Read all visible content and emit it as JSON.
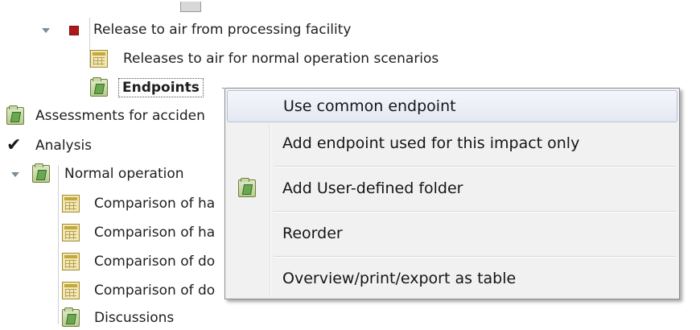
{
  "tree": {
    "items": [
      {
        "label": "Release to air from processing facility"
      },
      {
        "label": "Releases to air for normal operation scenarios"
      },
      {
        "label": "Endpoints"
      },
      {
        "label": "Assessments for acciden"
      },
      {
        "label": "Analysis"
      },
      {
        "label": "Normal operation"
      },
      {
        "label": "Comparison of ha"
      },
      {
        "label": "Comparison of ha"
      },
      {
        "label": "Comparison of do"
      },
      {
        "label": "Comparison of do"
      },
      {
        "label": "Discussions"
      }
    ]
  },
  "context_menu": {
    "items": [
      {
        "label": "Use common endpoint",
        "highlighted": true
      },
      {
        "label": "Add endpoint used for this impact only"
      },
      {
        "label": "Add User-defined folder",
        "icon": "folder-icon"
      },
      {
        "label": "Reorder"
      },
      {
        "label": "Overview/print/export as table"
      }
    ]
  },
  "colors": {
    "menu_background": "#f1f1f1",
    "highlight_border": "#b7c2d6",
    "red_marker": "#b01818"
  }
}
